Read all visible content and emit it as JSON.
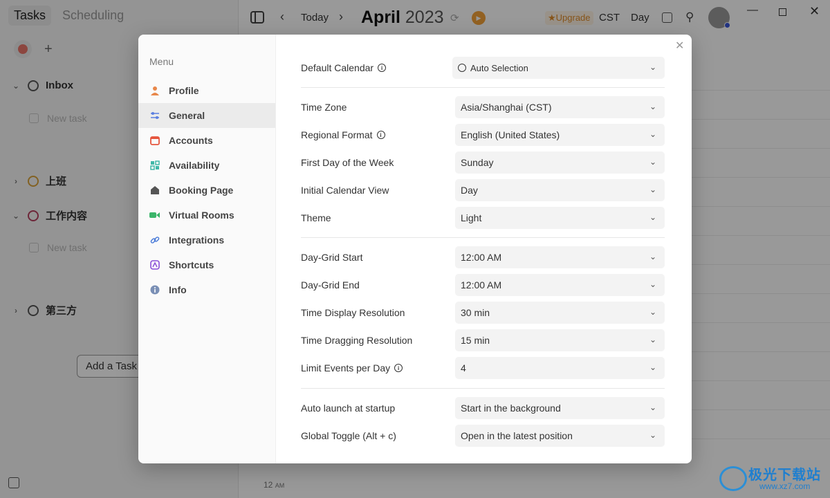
{
  "left_pane": {
    "tabs": [
      "Tasks",
      "Scheduling"
    ],
    "groups": [
      {
        "name": "Inbox",
        "color": "#555555",
        "expanded": true
      },
      {
        "name": "上班",
        "color": "#d9a23a",
        "expanded": false
      },
      {
        "name": "工作内容",
        "color": "#b6405f",
        "expanded": true
      },
      {
        "name": "第三方",
        "color": "#555555",
        "expanded": false
      }
    ],
    "new_task_placeholder": "New task",
    "add_task_label": "Add a Task I"
  },
  "topbar": {
    "today": "Today",
    "month": "April",
    "year": "2023",
    "upgrade": "★Upgrade",
    "timezone": "CST",
    "view": "Day"
  },
  "calendar": {
    "hour_label": "12",
    "hour_suffix": "AM"
  },
  "modal": {
    "menu_heading": "Menu",
    "menu_items": [
      {
        "label": "Profile",
        "icon": "person-icon",
        "color": "#e8874a"
      },
      {
        "label": "General",
        "icon": "sliders-icon",
        "color": "#5b7fe0"
      },
      {
        "label": "Accounts",
        "icon": "calendar-icon",
        "color": "#e5553d"
      },
      {
        "label": "Availability",
        "icon": "grid-icon",
        "color": "#3fb8a8"
      },
      {
        "label": "Booking Page",
        "icon": "home-icon",
        "color": "#555555"
      },
      {
        "label": "Virtual Rooms",
        "icon": "video-icon",
        "color": "#3bb56a"
      },
      {
        "label": "Integrations",
        "icon": "link-icon",
        "color": "#4a7bd8"
      },
      {
        "label": "Shortcuts",
        "icon": "keyboard-icon",
        "color": "#8a4fd8"
      },
      {
        "label": "Info",
        "icon": "info-icon",
        "color": "#7a8fb5"
      }
    ],
    "active_item": "General",
    "settings": {
      "default_calendar": {
        "label": "Default Calendar",
        "value": "Auto Selection"
      },
      "time_zone": {
        "label": "Time Zone",
        "value": "Asia/Shanghai (CST)"
      },
      "regional_format": {
        "label": "Regional Format",
        "value": "English (United States)"
      },
      "first_day": {
        "label": "First Day of the Week",
        "value": "Sunday"
      },
      "initial_view": {
        "label": "Initial Calendar View",
        "value": "Day"
      },
      "theme": {
        "label": "Theme",
        "value": "Light"
      },
      "grid_start": {
        "label": "Day-Grid Start",
        "value": "12:00 AM"
      },
      "grid_end": {
        "label": "Day-Grid End",
        "value": "12:00 AM"
      },
      "display_resolution": {
        "label": "Time Display Resolution",
        "value": "30 min"
      },
      "drag_resolution": {
        "label": "Time Dragging Resolution",
        "value": "15 min"
      },
      "limit_events": {
        "label": "Limit Events per Day",
        "value": "4"
      },
      "auto_launch": {
        "label": "Auto launch at startup",
        "value": "Start in the background"
      },
      "global_toggle": {
        "label": "Global Toggle (Alt + c)",
        "value": "Open in the latest position"
      }
    }
  },
  "watermark": {
    "text": "极光下载站",
    "url": "www.xz7.com"
  }
}
